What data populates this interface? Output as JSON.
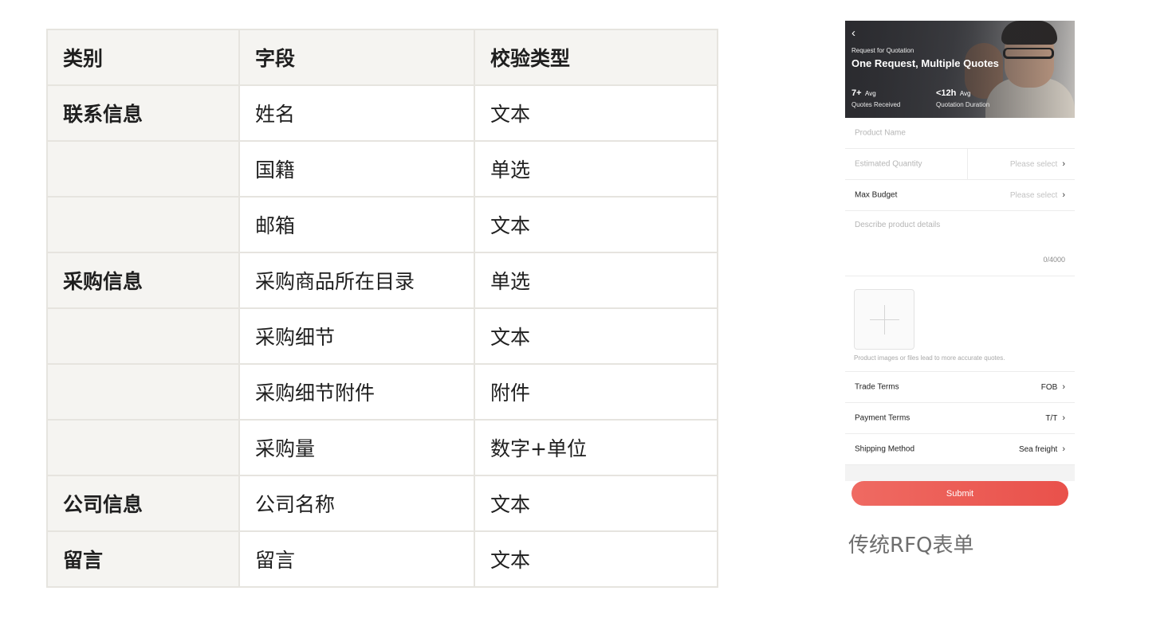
{
  "table": {
    "headers": [
      "类别",
      "字段",
      "校验类型"
    ],
    "rows": [
      [
        "联系信息",
        "姓名",
        "文本"
      ],
      [
        "",
        "国籍",
        "单选"
      ],
      [
        "",
        "邮箱",
        "文本"
      ],
      [
        "采购信息",
        "采购商品所在目录",
        "单选"
      ],
      [
        "",
        "采购细节",
        "文本"
      ],
      [
        "",
        "采购细节附件",
        "附件"
      ],
      [
        "",
        "采购量",
        "数字+单位"
      ],
      [
        "公司信息",
        "公司名称",
        "文本"
      ],
      [
        "留言",
        "留言",
        "文本"
      ]
    ]
  },
  "rfq": {
    "back_icon": "chevron-left-icon",
    "eyebrow": "Request for Quotation",
    "headline": "One Request, Multiple Quotes",
    "stat1": {
      "num": "7+",
      "avg": "Avg",
      "caption": "Quotes Received"
    },
    "stat2": {
      "num": "<12h",
      "avg": "Avg",
      "caption": "Quotation Duration"
    },
    "product_name_placeholder": "Product Name",
    "estimated_quantity_placeholder": "Estimated Quantity",
    "estimated_quantity_value": "Please select",
    "max_budget_label": "Max Budget",
    "max_budget_value": "Please select",
    "describe_placeholder": "Describe product details",
    "char_count": "0/4000",
    "upload_hint": "Product images or files lead to more accurate quotes.",
    "trade_terms_label": "Trade Terms",
    "trade_terms_value": "FOB",
    "payment_terms_label": "Payment Terms",
    "payment_terms_value": "T/T",
    "shipping_method_label": "Shipping Method",
    "shipping_method_value": "Sea freight",
    "chevron": "›",
    "submit_label": "Submit"
  },
  "caption": "传统RFQ表单"
}
